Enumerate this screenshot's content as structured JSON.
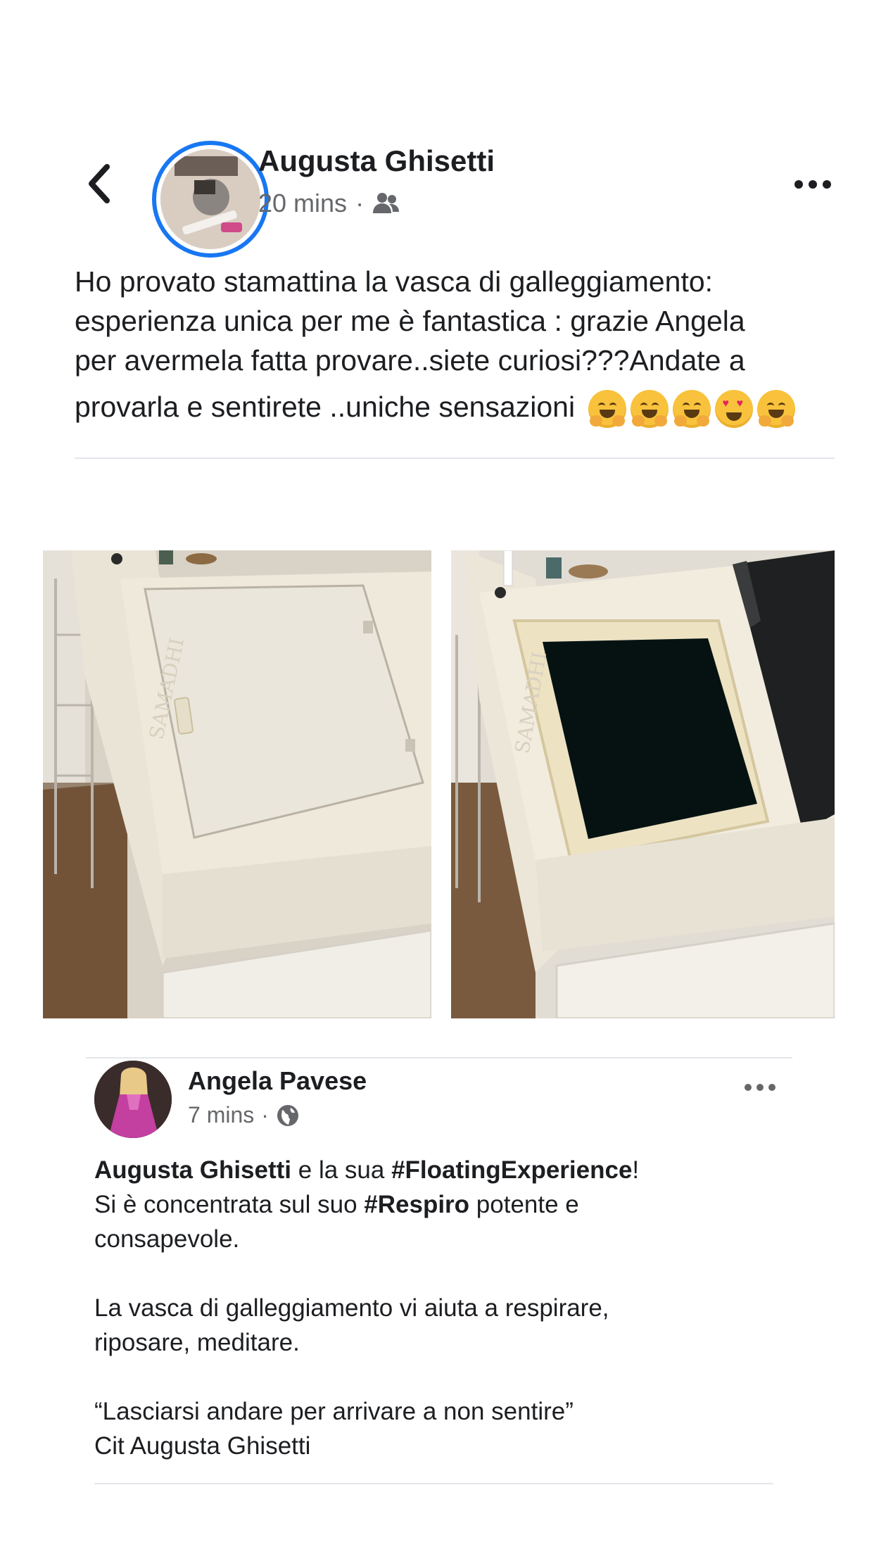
{
  "post": {
    "author": "Augusta Ghisetti",
    "time": "20 mins",
    "separator": "·",
    "audience_icon": "friends-icon",
    "text_lines": [
      "Ho provato stamattina la vasca di galleggiamento:",
      "esperienza unica per me è fantastica : grazie Angela",
      "per avermela fatta provare..siete curiosi???Andate a",
      "provarla e sentirete ..uniche sensazioni"
    ],
    "emojis": [
      "hugging-face",
      "hugging-face",
      "hugging-face",
      "heart-eyes-face",
      "hugging-face"
    ],
    "photos": [
      "float-tank-closed-photo",
      "float-tank-open-photo"
    ],
    "photo_watermark": "SAMADHI"
  },
  "shared": {
    "author": "Angela Pavese",
    "time": "7 mins",
    "separator": "·",
    "audience_icon": "globe-icon",
    "line1": {
      "mention": "Augusta Ghisetti",
      "middle": " e la sua ",
      "hashtag": "#FloatingExperience",
      "end": "!"
    },
    "line2": {
      "start": "Si è concentrata sul suo ",
      "hashtag": "#Respiro",
      "end": " potente e"
    },
    "line3": "consapevole.",
    "line4": "La vasca di galleggiamento vi aiuta a respirare,",
    "line5": "riposare, meditare.",
    "line6": "“Lasciarsi andare per arrivare a non sentire”",
    "line7": "Cit Augusta Ghisetti"
  },
  "icons": {
    "back": "chevron-left-icon",
    "more": "more-dots-icon"
  },
  "colors": {
    "accent": "#1877f2",
    "text": "#1c1e21",
    "secondary": "#65676b",
    "divider": "#e4e6eb"
  }
}
